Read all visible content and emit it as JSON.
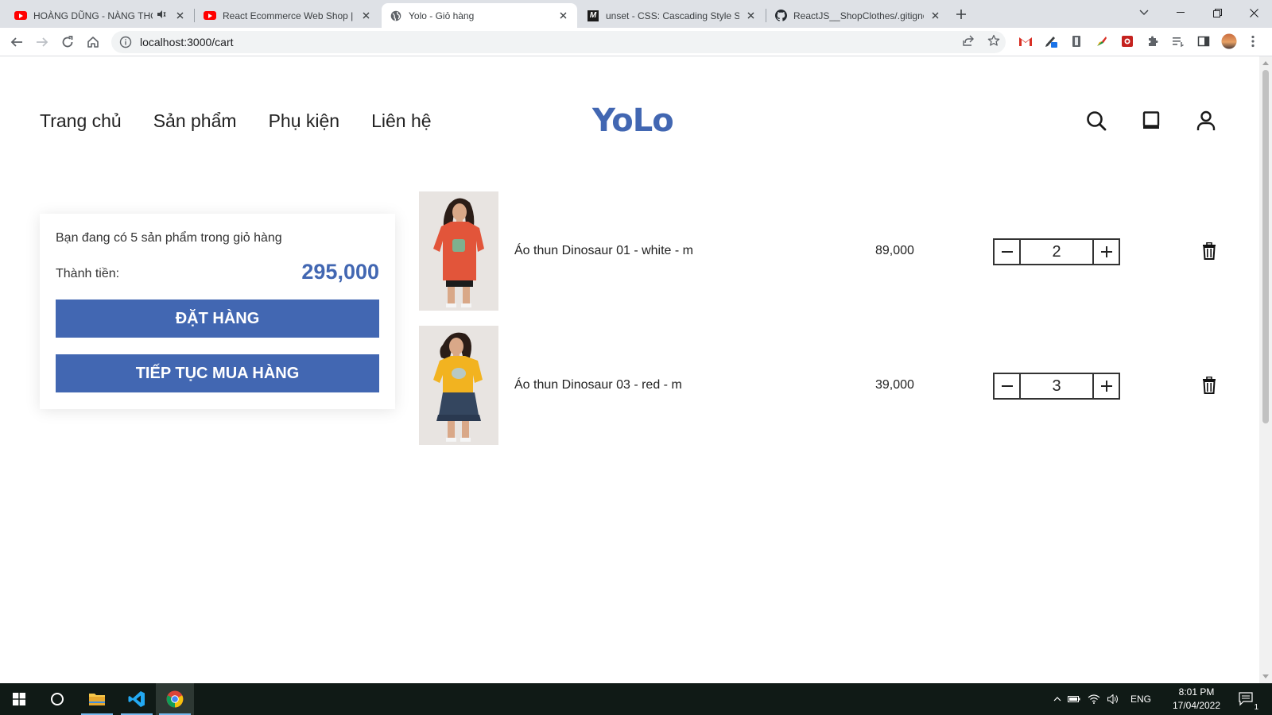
{
  "browser": {
    "tabs": [
      {
        "title": "HOÀNG DŨNG - NÀNG THƠ",
        "favicon": "youtube-icon",
        "audio": true
      },
      {
        "title": "React Ecommerce Web Shop | Pa",
        "favicon": "youtube-icon"
      },
      {
        "title": "Yolo - Giỏ hàng",
        "favicon": "globe-icon",
        "active": true
      },
      {
        "title": "unset - CSS: Cascading Style Shee",
        "favicon": "mdn-icon"
      },
      {
        "title": "ReactJS__ShopClothes/.gitignore",
        "favicon": "github-icon"
      }
    ],
    "url": "localhost:3000/cart"
  },
  "header": {
    "nav": [
      "Trang chủ",
      "Sản phẩm",
      "Phụ kiện",
      "Liên hệ"
    ],
    "logo": "YoLo",
    "icons": [
      "search-icon",
      "tablet-icon",
      "user-icon"
    ]
  },
  "cart": {
    "summary_text": "Bạn đang có 5 sản phẩm trong giỏ hàng",
    "total_label": "Thành tiền:",
    "total_value": "295,000",
    "order_button": "ĐẶT HÀNG",
    "continue_button": "TIẾP TỤC MUA HÀNG",
    "items": [
      {
        "name": "Áo thun Dinosaur 01 - white - m",
        "price": "89,000",
        "quantity": "2",
        "shirt_color": "#e2553a"
      },
      {
        "name": "Áo thun Dinosaur 03 - red - m",
        "price": "39,000",
        "quantity": "3",
        "shirt_color": "#f2b320"
      }
    ]
  },
  "taskbar": {
    "language": "ENG",
    "time": "8:01 PM",
    "date": "17/04/2022",
    "notification_count": "1"
  },
  "colors": {
    "accent": "#4267b2",
    "taskbar": "#101a16",
    "tabstrip": "#dee1e6"
  }
}
